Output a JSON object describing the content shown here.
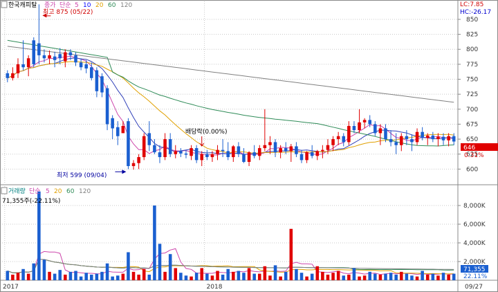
{
  "chart_data": [
    {
      "type": "candlestick",
      "title": "한국캐피탈",
      "legend": [
        "종가",
        "단순",
        "5",
        "10",
        "20",
        "60",
        "120"
      ],
      "legend_colors": [
        "#cc44aa",
        "#cc44aa",
        "#cc44aa",
        "#0000ff",
        "#e0a000",
        "#2e8b57",
        "#808080"
      ],
      "ylim": [
        575,
        880
      ],
      "yticks": [
        850,
        825,
        800,
        775,
        750,
        725,
        700,
        675,
        650,
        625,
        600
      ],
      "lc_label": "LC:7.85",
      "hc_label": "HC:-26.17",
      "current_price": "646",
      "current_change": "0.31%",
      "annotations": {
        "high": "최고 875 (05/22)",
        "low": "최저 599 (09/04)",
        "dividend": "배당락(0.00%)"
      },
      "candles": [
        [
          760,
          765,
          745,
          752
        ],
        [
          752,
          770,
          748,
          760
        ],
        [
          760,
          785,
          752,
          775
        ],
        [
          775,
          815,
          765,
          770
        ],
        [
          770,
          790,
          755,
          785
        ],
        [
          815,
          820,
          770,
          775
        ],
        [
          810,
          875,
          775,
          790
        ],
        [
          790,
          800,
          778,
          785
        ],
        [
          785,
          798,
          775,
          790
        ],
        [
          788,
          796,
          770,
          782
        ],
        [
          792,
          802,
          775,
          785
        ],
        [
          780,
          800,
          770,
          795
        ],
        [
          795,
          800,
          782,
          790
        ],
        [
          790,
          795,
          772,
          778
        ],
        [
          778,
          785,
          765,
          770
        ],
        [
          775,
          782,
          760,
          768
        ],
        [
          770,
          778,
          748,
          752
        ],
        [
          765,
          770,
          720,
          730
        ],
        [
          755,
          760,
          720,
          728
        ],
        [
          735,
          740,
          665,
          675
        ],
        [
          685,
          690,
          650,
          668
        ],
        [
          670,
          680,
          640,
          655
        ],
        [
          660,
          680,
          660,
          672
        ],
        [
          680,
          685,
          600,
          605
        ],
        [
          605,
          615,
          599,
          610
        ],
        [
          610,
          625,
          600,
          620
        ],
        [
          620,
          660,
          615,
          655
        ],
        [
          660,
          680,
          630,
          640
        ],
        [
          640,
          650,
          625,
          628
        ],
        [
          628,
          640,
          610,
          620
        ],
        [
          620,
          660,
          615,
          650
        ],
        [
          650,
          660,
          620,
          625
        ],
        [
          625,
          640,
          618,
          630
        ],
        [
          630,
          635,
          620,
          626
        ],
        [
          626,
          632,
          618,
          624
        ],
        [
          622,
          640,
          615,
          635
        ],
        [
          635,
          640,
          610,
          615
        ],
        [
          615,
          630,
          605,
          625
        ],
        [
          625,
          632,
          615,
          620
        ],
        [
          620,
          630,
          612,
          625
        ],
        [
          625,
          640,
          615,
          632
        ],
        [
          632,
          650,
          620,
          630
        ],
        [
          630,
          645,
          615,
          620
        ],
        [
          620,
          640,
          612,
          638
        ],
        [
          638,
          645,
          620,
          625
        ],
        [
          625,
          635,
          610,
          612
        ],
        [
          612,
          630,
          605,
          628
        ],
        [
          628,
          640,
          618,
          622
        ],
        [
          622,
          640,
          615,
          635
        ],
        [
          635,
          700,
          630,
          640
        ],
        [
          640,
          655,
          625,
          645
        ],
        [
          645,
          650,
          620,
          628
        ],
        [
          628,
          640,
          618,
          635
        ],
        [
          635,
          645,
          625,
          630
        ],
        [
          630,
          642,
          612,
          638
        ],
        [
          638,
          645,
          620,
          625
        ],
        [
          625,
          632,
          610,
          615
        ],
        [
          615,
          630,
          610,
          628
        ],
        [
          628,
          640,
          618,
          622
        ],
        [
          622,
          632,
          615,
          630
        ],
        [
          630,
          640,
          618,
          632
        ],
        [
          632,
          650,
          625,
          640
        ],
        [
          640,
          655,
          630,
          650
        ],
        [
          650,
          662,
          640,
          655
        ],
        [
          655,
          660,
          638,
          645
        ],
        [
          645,
          680,
          640,
          672
        ],
        [
          672,
          680,
          660,
          665
        ],
        [
          665,
          700,
          660,
          678
        ],
        [
          678,
          685,
          668,
          682
        ],
        [
          682,
          690,
          670,
          675
        ],
        [
          675,
          680,
          655,
          660
        ],
        [
          660,
          675,
          640,
          668
        ],
        [
          668,
          675,
          645,
          650
        ],
        [
          650,
          665,
          638,
          645
        ],
        [
          645,
          660,
          625,
          640
        ],
        [
          640,
          660,
          630,
          655
        ],
        [
          655,
          665,
          640,
          650
        ],
        [
          650,
          658,
          630,
          645
        ],
        [
          645,
          668,
          640,
          662
        ],
        [
          662,
          670,
          648,
          652
        ],
        [
          652,
          660,
          640,
          656
        ],
        [
          656,
          662,
          645,
          650
        ],
        [
          650,
          660,
          638,
          654
        ],
        [
          654,
          660,
          640,
          648
        ],
        [
          648,
          660,
          638,
          655
        ],
        [
          655,
          660,
          640,
          646
        ]
      ],
      "x_tick_labels": [
        "2017",
        "2018",
        "09/27"
      ]
    },
    {
      "type": "bar",
      "title": "거래량",
      "legend": [
        "거래량",
        "단순",
        "5",
        "20",
        "60",
        "120"
      ],
      "legend_colors": [
        "#008080",
        "#cc44aa",
        "#cc44aa",
        "#e0a000",
        "#2e8b57",
        "#808080"
      ],
      "subtitle": "71,355주(-22.11%)",
      "ylim": [
        0,
        10000
      ],
      "yticks": [
        "8,000K",
        "6,000K",
        "4,000K",
        "2,000K"
      ],
      "current_volume": "71,355",
      "current_ratio": "22.11%",
      "volumes": [
        1000,
        600,
        800,
        1200,
        700,
        1800,
        9500,
        2200,
        900,
        700,
        1100,
        600,
        900,
        1000,
        400,
        800,
        600,
        700,
        900,
        1800,
        400,
        500,
        700,
        3000,
        900,
        600,
        1200,
        600,
        8000,
        3900,
        900,
        2800,
        1300,
        800,
        500,
        400,
        800,
        1300,
        700,
        500,
        1000,
        600,
        1200,
        900,
        1000,
        800,
        1300,
        700,
        700,
        1500,
        500,
        1600,
        400,
        900,
        5500,
        1200,
        800,
        400,
        700,
        1500,
        900,
        600,
        800,
        1000,
        500,
        600,
        1300,
        400,
        500,
        900,
        700,
        600,
        700,
        800,
        600,
        900,
        700,
        500,
        400,
        1000,
        600,
        700,
        500,
        800,
        600,
        700
      ]
    }
  ]
}
